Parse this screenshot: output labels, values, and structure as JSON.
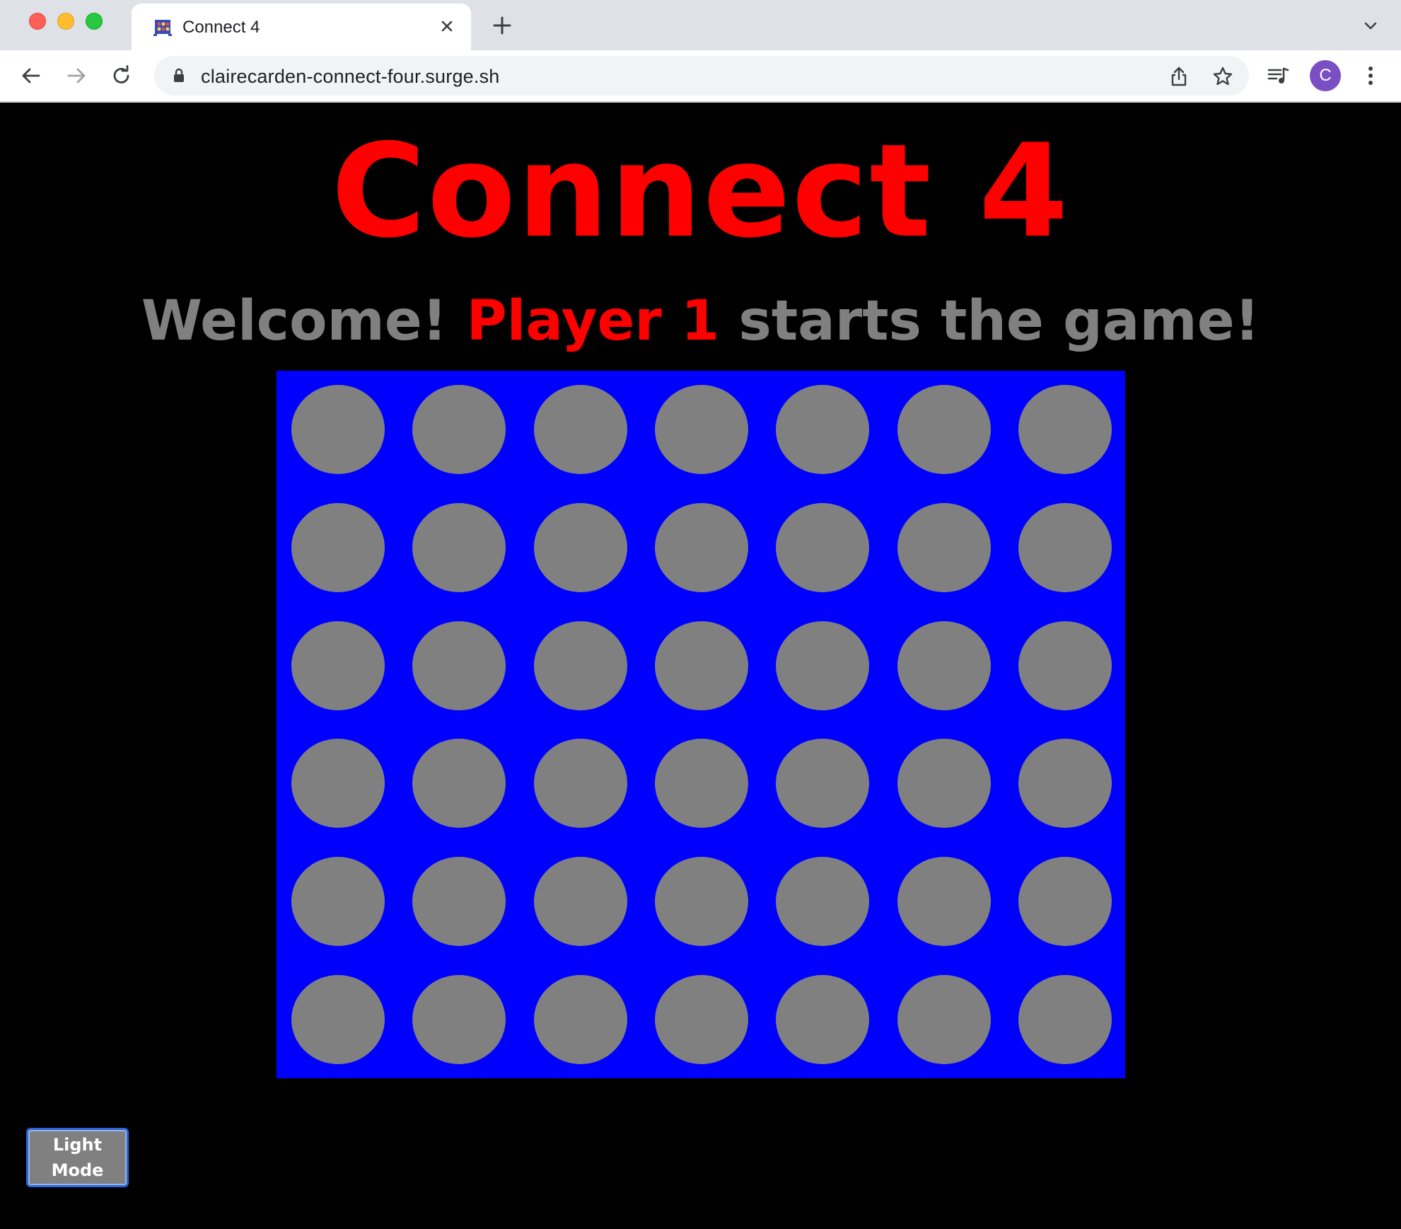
{
  "browser": {
    "tab_title": "Connect 4",
    "url": "clairecarden-connect-four.surge.sh",
    "avatar_letter": "C",
    "new_tab_label": "+",
    "icons": [
      "favicon",
      "close-icon",
      "plus-icon",
      "chevron-down-icon",
      "back-arrow-icon",
      "forward-arrow-icon",
      "reload-icon",
      "lock-icon",
      "share-icon",
      "star-icon",
      "media-queue-icon",
      "kebab-menu-icon"
    ]
  },
  "game": {
    "title": "Connect 4",
    "status_prefix": "Welcome!",
    "status_player": "Player 1",
    "status_suffix": "starts the game!",
    "rows": 6,
    "columns": 7,
    "board_color": "#0000ff",
    "empty_cell_color": "#808080",
    "player1_color": "#ff0000",
    "board": [
      [
        "empty",
        "empty",
        "empty",
        "empty",
        "empty",
        "empty",
        "empty"
      ],
      [
        "empty",
        "empty",
        "empty",
        "empty",
        "empty",
        "empty",
        "empty"
      ],
      [
        "empty",
        "empty",
        "empty",
        "empty",
        "empty",
        "empty",
        "empty"
      ],
      [
        "empty",
        "empty",
        "empty",
        "empty",
        "empty",
        "empty",
        "empty"
      ],
      [
        "empty",
        "empty",
        "empty",
        "empty",
        "empty",
        "empty",
        "empty"
      ],
      [
        "empty",
        "empty",
        "empty",
        "empty",
        "empty",
        "empty",
        "empty"
      ]
    ]
  },
  "controls": {
    "mode_button_label": "Light Mode"
  }
}
